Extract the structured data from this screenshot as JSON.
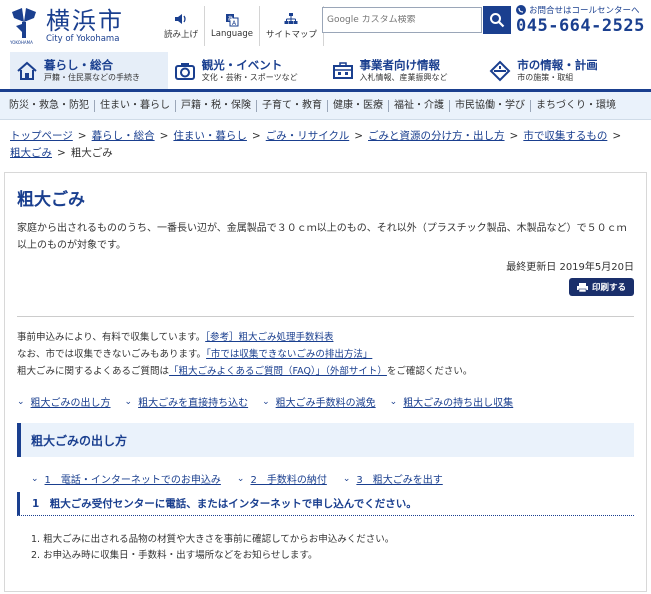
{
  "header": {
    "logo_kanji": "横浜市",
    "logo_en": "City of Yokohama",
    "util": [
      {
        "label": "読み上げ",
        "icon": "speaker-icon"
      },
      {
        "label": "Language",
        "icon": "translate-icon"
      },
      {
        "label": "サイトマップ",
        "icon": "sitemap-icon"
      }
    ],
    "search_placeholder": "Google カスタム検索",
    "contact_label": "お問合せはコールセンターへ",
    "contact_number": "045-664-2525"
  },
  "main_nav": [
    {
      "title": "暮らし・総合",
      "sub": "戸籍・住民票などの手続き",
      "icon": "home-icon"
    },
    {
      "title": "観光・イベント",
      "sub": "文化・芸術・スポーツなど",
      "icon": "camera-icon"
    },
    {
      "title": "事業者向け情報",
      "sub": "入札情報、産業振興など",
      "icon": "building-icon"
    },
    {
      "title": "市の情報・計画",
      "sub": "市の施策・取組",
      "icon": "compass-icon"
    }
  ],
  "sub_nav": [
    "防災・救急・防犯",
    "住まい・暮らし",
    "戸籍・税・保険",
    "子育て・教育",
    "健康・医療",
    "福祉・介護",
    "市民協働・学び",
    "まちづくり・環境"
  ],
  "breadcrumb": {
    "links": [
      "トップページ",
      "暮らし・総合",
      "住まい・暮らし",
      "ごみ・リサイクル",
      "ごみと資源の分け方・出し方",
      "市で収集するもの",
      "粗大ごみ"
    ],
    "current": "粗大ごみ"
  },
  "page": {
    "title": "粗大ごみ",
    "lead_1": "家庭から出されるもののうち、一番長い辺が、金属製品で３０ｃｍ以上のもの、それ以外（プラスチック製品、木製品など）で５０ｃｍ",
    "lead_2": "以上のものが対象です。",
    "updated": "最終更新日 2019年5月20日",
    "print_label": "印刷する",
    "notice_1_text": "事前申込みにより、有料で収集しています。",
    "notice_1_link": "［参考］粗大ごみ処理手数料表",
    "notice_2_text": "なお、市では収集できないごみもあります。",
    "notice_2_link": "「市では収集できないごみの排出方法」",
    "notice_3_text": "粗大ごみに関するよくあるご質問は",
    "notice_3_link": "「粗大ごみよくあるご質問（FAQ）」（外部サイト）",
    "notice_3_tail": "をご確認ください。",
    "anchors": [
      "粗大ごみの出し方",
      "粗大ごみを直接持ち込む",
      "粗大ごみ手数料の減免",
      "粗大ごみの持ち出し収集"
    ],
    "section_title": "粗大ごみの出し方",
    "steps": [
      "1　電話・インターネットでのお申込み",
      "2　手数料の納付",
      "3　粗大ごみを出す"
    ],
    "step1_heading": "1　粗大ごみ受付センターに電話、またはインターネットで申し込んでください。",
    "list": [
      "1. 粗大ごみに出される品物の材質や大きさを事前に確認してからお申込みください。",
      "2. お申込み時に収集日・手数料・出す場所などをお知らせします。"
    ]
  },
  "colors": {
    "brand": "#1a3f8f",
    "nav_bg": "#eaf2fb"
  }
}
